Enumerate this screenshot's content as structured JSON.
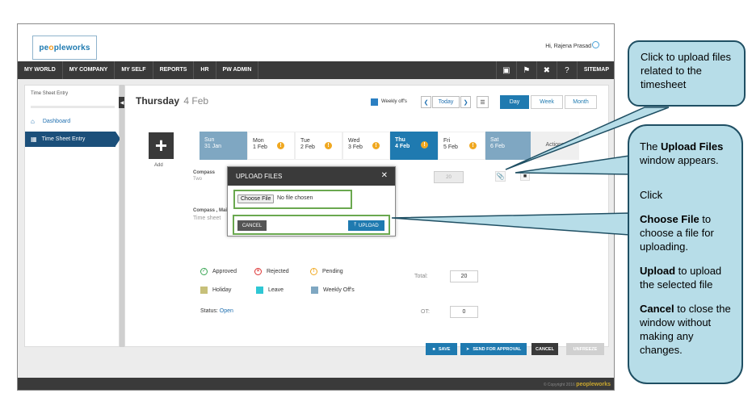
{
  "app": {
    "logo": {
      "pre": "pe",
      "hl": "o",
      "post": "pleworks"
    },
    "greeting": "Hi, Rajena Prasad"
  },
  "nav": {
    "items": [
      "MY WORLD",
      "MY COMPANY",
      "MY SELF",
      "REPORTS",
      "HR",
      "PW ADMIN"
    ],
    "sitemap": "SITEMAP",
    "icons": [
      "book-icon",
      "flag-icon",
      "tools-icon",
      "help-icon"
    ]
  },
  "sidebar": {
    "title": "Time Sheet Entry",
    "dashboard": "Dashboard",
    "active": "Time Sheet Entry"
  },
  "header": {
    "day": "Thursday",
    "date": "4 Feb",
    "weekly_offs": "Weekly off's",
    "today": "Today",
    "views": [
      "Day",
      "Week",
      "Month"
    ]
  },
  "days": [
    {
      "name": "Sun",
      "date": "31 Jan",
      "type": "weekly-off"
    },
    {
      "name": "Mon",
      "date": "1 Feb",
      "type": "normal",
      "pending": true
    },
    {
      "name": "Tue",
      "date": "2 Feb",
      "type": "normal",
      "pending": true
    },
    {
      "name": "Wed",
      "date": "3 Feb",
      "type": "normal",
      "pending": true
    },
    {
      "name": "Thu",
      "date": "4 Feb",
      "type": "selected",
      "pending": true
    },
    {
      "name": "Fri",
      "date": "5 Feb",
      "type": "normal",
      "pending": true
    },
    {
      "name": "Sat",
      "date": "6 Feb",
      "type": "weekly-off"
    }
  ],
  "actions_label": "Actions",
  "add_label": "Add",
  "rows": [
    {
      "project": "Compass",
      "task": "Two",
      "hours": "20"
    },
    {
      "project": "Compass , Main",
      "task": "Time sheet"
    }
  ],
  "legend": {
    "approved": "Approved",
    "rejected": "Rejected",
    "pending": "Pending",
    "holiday": "Holiday",
    "leave": "Leave",
    "weekly_offs": "Weekly Off's"
  },
  "status": {
    "label": "Status:",
    "value": "Open"
  },
  "totals": {
    "total_label": "Total:",
    "total": "20",
    "ot_label": "OT:",
    "ot": "0"
  },
  "buttons": {
    "save": "SAVE",
    "send": "SEND FOR APPROVAL",
    "cancel": "CANCEL",
    "unfreeze": "UNFREEZE"
  },
  "footer": {
    "copyright": "© Copyright 2016",
    "brand": "peopleworks"
  },
  "modal": {
    "title": "UPLOAD FILES",
    "choose_file": "Choose File",
    "no_file": "No file chosen",
    "cancel": "CANCEL",
    "upload": "UPLOAD"
  },
  "callouts": {
    "c1": "Click to upload files related to the timesheet",
    "c2": {
      "intro_bold": "Upload Files",
      "intro_pre": "The ",
      "intro_post": " window appears.",
      "click": "Click",
      "choose_bold": "Choose File",
      "choose_post": " to choose a file for uploading.",
      "upload_bold": "Upload",
      "upload_post": " to upload the selected file",
      "cancel_bold": "Cancel",
      "cancel_post": " to close the window without making any changes."
    }
  },
  "colors": {
    "nav": "#3a3a3a",
    "sidebar_active": "#1b4f7a",
    "selected_day": "#1f7ab0",
    "weekly_off": "#7fa7c2",
    "primary_btn": "#1f7ab0",
    "callout_fill": "#b7dde8",
    "highlight": "#6aa84f"
  }
}
